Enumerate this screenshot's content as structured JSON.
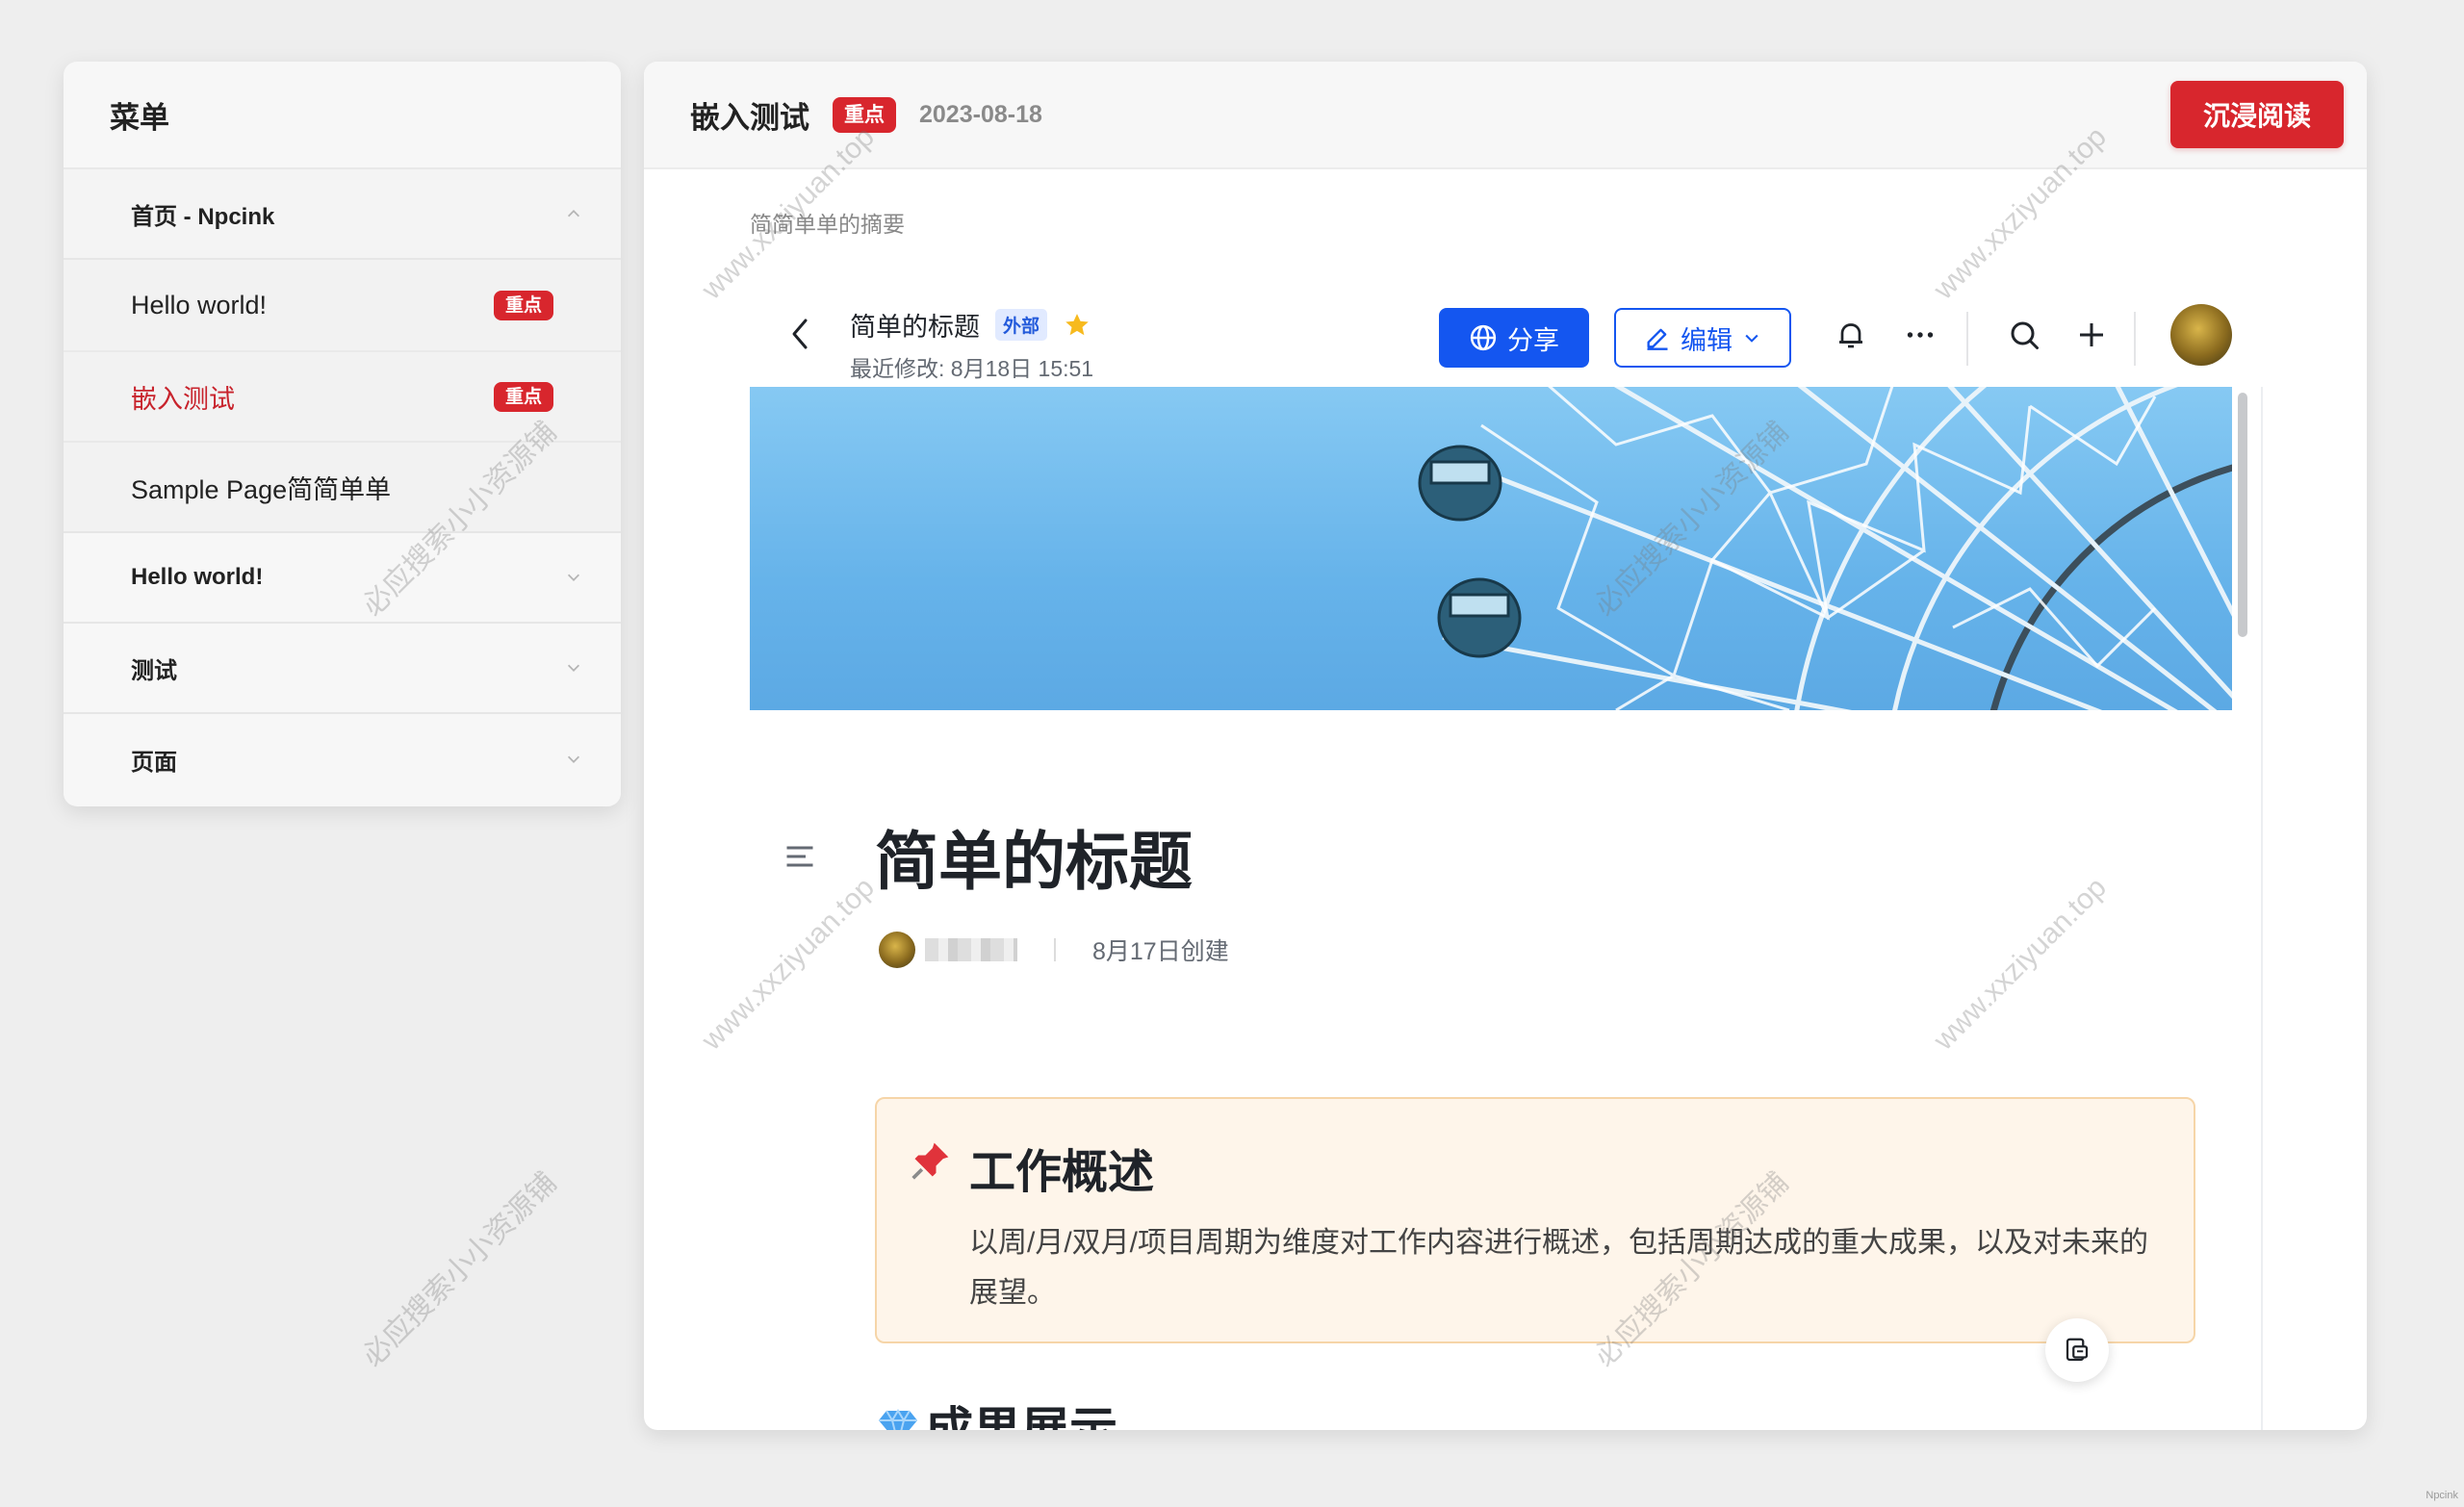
{
  "menu": {
    "title": "菜单",
    "groups": [
      {
        "label": "首页 - Npcink",
        "expanded": true,
        "items": [
          {
            "label": "Hello world!",
            "badge": "重点",
            "active": false
          },
          {
            "label": "嵌入测试",
            "badge": "重点",
            "active": true
          },
          {
            "label": "Sample Page简简单单",
            "badge": null,
            "active": false
          }
        ]
      },
      {
        "label": "Hello world!",
        "expanded": false
      },
      {
        "label": "测试",
        "expanded": false
      },
      {
        "label": "页面",
        "expanded": false
      }
    ]
  },
  "header": {
    "title": "嵌入测试",
    "badge": "重点",
    "date": "2023-08-18",
    "read_button": "沉浸阅读"
  },
  "summary": "简简单单的摘要",
  "doc": {
    "toolbar": {
      "title": "简单的标题",
      "tag": "外部",
      "modified": "最近修改: 8月18日 15:51",
      "share_label": "分享",
      "edit_label": "编辑"
    },
    "heading": "简单的标题",
    "created": "8月17日创建",
    "callout": {
      "title": "工作概述",
      "text": "以周/月/双月/项目周期为维度对工作内容进行概述，包括周期达成的重大成果，以及对未来的展望。"
    },
    "section_heading": "成果展示"
  },
  "watermarks": {
    "url": "www.xxziyuan.top",
    "cn": "必应搜索小小资源铺"
  },
  "corner_mark": "Npcink",
  "colors": {
    "brand_red": "#d8262d",
    "primary_blue": "#1456f0",
    "callout_bg": "#fef5ea"
  }
}
